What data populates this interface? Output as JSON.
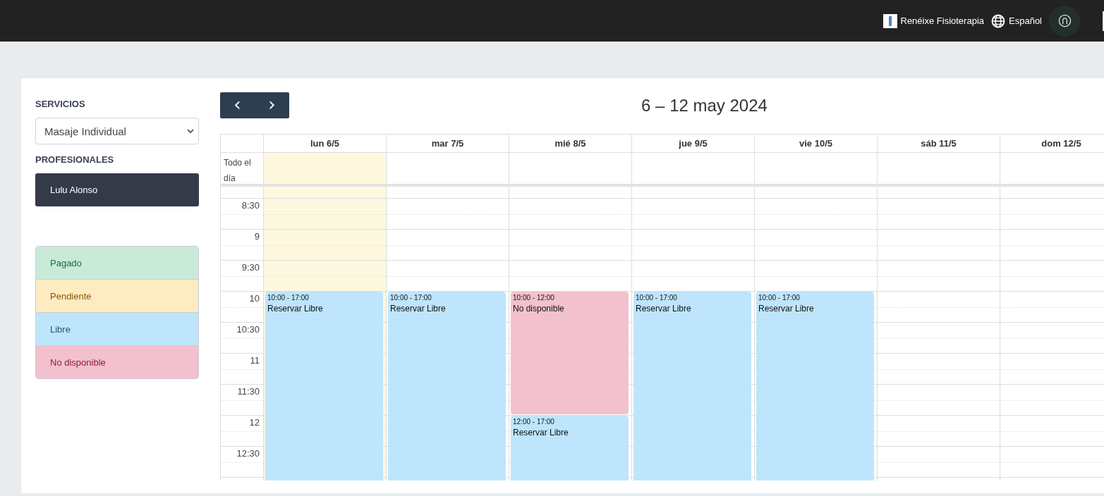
{
  "navbar": {
    "clinic": "Renéixe Fisioterapia",
    "language": "Español"
  },
  "sidebar": {
    "services_label": "SERVICIOS",
    "service": "Masaje Individual",
    "professionals_label": "PROFESIONALES",
    "professionals": [
      {
        "name": "Lulu Alonso",
        "selected": true
      }
    ],
    "legend": [
      {
        "label": "Pagado",
        "kind": "paid",
        "color": "#c8ebd9"
      },
      {
        "label": "Pendiente",
        "kind": "pending",
        "color": "#fdebc1"
      },
      {
        "label": "Libre",
        "kind": "free",
        "color": "#bfe5fb"
      },
      {
        "label": "No disponible",
        "kind": "unavailable",
        "color": "#f3c1ce"
      }
    ]
  },
  "calendar": {
    "prev": "‹",
    "next": "›",
    "title": "6 – 12 may 2024",
    "all_day_label": "Todo el día",
    "slots": [
      "8:30",
      "9",
      "9:30",
      "10",
      "10:30",
      "11",
      "11:30",
      "12",
      "12:30"
    ],
    "days": [
      {
        "label": "lun 6/5",
        "today": true,
        "events": [
          {
            "time": "10:00 - 17:00",
            "title": "Reservar Libre",
            "kind": "free"
          }
        ]
      },
      {
        "label": "mar 7/5",
        "today": false,
        "events": [
          {
            "time": "10:00 - 17:00",
            "title": "Reservar Libre",
            "kind": "free"
          }
        ]
      },
      {
        "label": "mié 8/5",
        "today": false,
        "events": [
          {
            "time": "10:00 - 12:00",
            "title": "No disponible",
            "kind": "unavailable"
          },
          {
            "time": "12:00 - 17:00",
            "title": "Reservar Libre",
            "kind": "free"
          }
        ]
      },
      {
        "label": "jue 9/5",
        "today": false,
        "events": [
          {
            "time": "10:00 - 17:00",
            "title": "Reservar Libre",
            "kind": "free"
          }
        ]
      },
      {
        "label": "vie 10/5",
        "today": false,
        "events": [
          {
            "time": "10:00 - 17:00",
            "title": "Reservar Libre",
            "kind": "free"
          }
        ]
      },
      {
        "label": "sáb 11/5",
        "today": false
      },
      {
        "label": "dom 12/5",
        "today": false
      }
    ]
  }
}
